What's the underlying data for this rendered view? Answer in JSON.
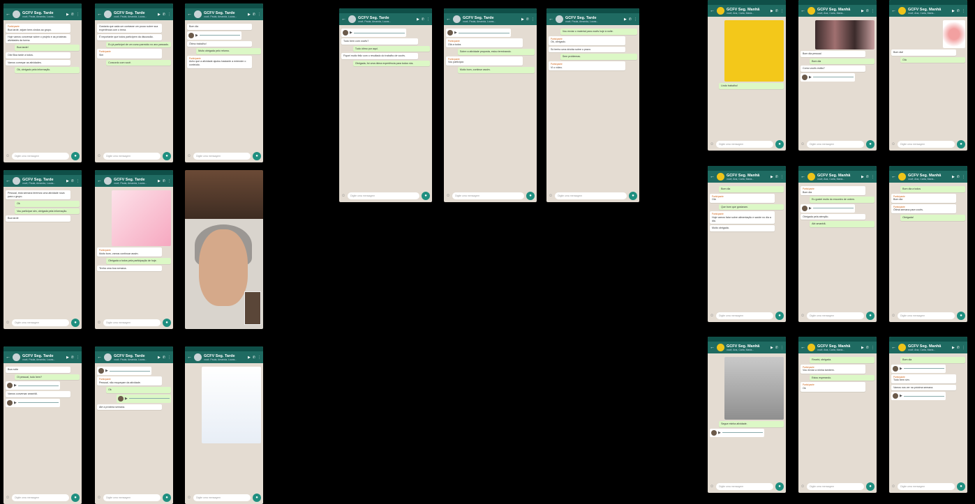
{
  "screens": [
    {
      "id": "p1",
      "title": "GCFV Seg. Tarde",
      "subtitle": "você, Paula, Amanda, Lucas...",
      "input": "Digite uma mensagem",
      "messages": [
        {
          "dir": "in",
          "sender": true,
          "text": "Boa tarde, sejam bem-vindos ao grupo."
        },
        {
          "dir": "in",
          "text": "Hoje vamos conversar sobre o projeto e as próximas atividades da turma."
        },
        {
          "dir": "out",
          "text": "Boa tarde!"
        },
        {
          "dir": "in",
          "text": "Olá! Boa tarde a todos."
        },
        {
          "dir": "in",
          "text": "Vamos começar as atividades."
        },
        {
          "dir": "out",
          "text": "Ok, obrigado pela informação."
        }
      ]
    },
    {
      "id": "p2",
      "title": "GCFV Seg. Tarde",
      "subtitle": "você, Paula, Amanda, Lucas...",
      "input": "Digite uma mensagem",
      "messages": [
        {
          "dir": "in",
          "text": "Gostaria que cada um contasse um pouco sobre sua experiência com o tema."
        },
        {
          "dir": "in",
          "text": "É importante que todos participem da discussão."
        },
        {
          "dir": "out",
          "text": "Eu já participei de um curso parecido no ano passado."
        },
        {
          "dir": "in",
          "sender": true,
          "text": "Sim"
        },
        {
          "dir": "out",
          "text": "Concordo com você."
        }
      ]
    },
    {
      "id": "p3",
      "title": "GCFV Seg. Tarde",
      "subtitle": "você, Paula, Amanda, Lucas...",
      "input": "Digite uma mensagem",
      "messages": [
        {
          "dir": "in",
          "text": "Bom dia"
        },
        {
          "dir": "audio-in"
        },
        {
          "dir": "in",
          "text": "Ótimo trabalho!"
        },
        {
          "dir": "out",
          "text": "Muito obrigada pelo retorno."
        },
        {
          "dir": "in",
          "sender": true,
          "text": "Acho que a atividade ajudou bastante a entender o conteúdo."
        }
      ]
    },
    {
      "id": "p4",
      "title": "GCFV Seg. Tarde",
      "subtitle": "você, Paula, Amanda, Lucas...",
      "input": "Digite uma mensagem",
      "messages": [
        {
          "dir": "in",
          "text": "Pessoal, esta semana teremos uma atividade nova para o grupo."
        },
        {
          "dir": "out",
          "text": "Ok"
        },
        {
          "dir": "out",
          "text": "Vou participar sim, obrigada pela informação."
        },
        {
          "dir": "in",
          "text": "Boa tarde"
        }
      ]
    },
    {
      "id": "p5",
      "title": "GCFV Seg. Tarde",
      "subtitle": "você, Paula, Amanda, Lucas...",
      "input": "Digite uma mensagem",
      "image": "pink",
      "messages": [
        {
          "dir": "in",
          "sender": true,
          "text": "Muito bom, vamos continuar assim."
        },
        {
          "dir": "out",
          "text": "Obrigada a todos pela participação de hoje."
        },
        {
          "dir": "in",
          "text": "Tenha uma boa semana."
        }
      ]
    },
    {
      "id": "p6",
      "video": true
    },
    {
      "id": "p7",
      "title": "GCFV Seg. Tarde",
      "subtitle": "você, Paula, Amanda, Lucas...",
      "input": "Digite uma mensagem",
      "messages": [
        {
          "dir": "in",
          "text": "Boa noite"
        },
        {
          "dir": "out",
          "text": "Oi pessoal, tudo bem?"
        },
        {
          "dir": "audio-in"
        },
        {
          "dir": "in",
          "text": "Vamos conversar amanhã."
        },
        {
          "dir": "audio-in"
        }
      ]
    },
    {
      "id": "p8",
      "title": "GCFV Seg. Tarde",
      "subtitle": "você, Paula, Amanda, Lucas...",
      "input": "Digite uma mensagem",
      "messages": [
        {
          "dir": "audio-in"
        },
        {
          "dir": "in",
          "sender": true,
          "text": "Pessoal, não esqueçam da atividade."
        },
        {
          "dir": "out",
          "text": "Ok"
        },
        {
          "dir": "audio-out"
        },
        {
          "dir": "in",
          "text": "Até a próxima semana."
        }
      ]
    },
    {
      "id": "p9",
      "title": "GCFV Seg. Tarde",
      "subtitle": "você, Paula, Amanda, Lucas...",
      "input": "Digite uma mensagem",
      "image": "flyer",
      "messages": []
    },
    {
      "id": "c1",
      "title": "GCFV Seg. Tarde",
      "subtitle": "você, Paula, Amanda, Lucas...",
      "input": "Digite uma mensagem",
      "messages": [
        {
          "dir": "audio-in"
        },
        {
          "dir": "in",
          "text": "Tudo bem com vocês?"
        },
        {
          "dir": "out",
          "text": "Tudo ótimo por aqui."
        },
        {
          "dir": "in",
          "text": "Fiquei muito feliz com o resultado do trabalho de vocês."
        },
        {
          "dir": "out",
          "text": "Obrigada, foi uma ótima experiência para todos nós."
        }
      ]
    },
    {
      "id": "c2",
      "title": "GCFV Seg. Tarde",
      "subtitle": "você, Paula, Amanda, Lucas...",
      "input": "Digite uma mensagem",
      "messages": [
        {
          "dir": "audio-in"
        },
        {
          "dir": "in",
          "sender": true,
          "text": "Olá a todos"
        },
        {
          "dir": "out",
          "text": "Sobre a atividade proposta, estou terminando."
        },
        {
          "dir": "in",
          "sender": true,
          "text": "Vou participar."
        },
        {
          "dir": "out",
          "text": "Muito bom, continue assim."
        }
      ]
    },
    {
      "id": "c3",
      "title": "GCFV Seg. Tarde",
      "subtitle": "você, Paula, Amanda, Lucas...",
      "input": "Digite uma mensagem",
      "messages": [
        {
          "dir": "out",
          "text": "Vou enviar o material para vocês hoje à noite."
        },
        {
          "dir": "in",
          "sender": true,
          "text": "Ok, obrigado."
        },
        {
          "dir": "in",
          "text": "Só tenho uma dúvida sobre o prazo."
        },
        {
          "dir": "out",
          "text": "Sem problemas."
        },
        {
          "dir": "in",
          "sender": true,
          "text": "Vi o vídeo."
        }
      ]
    },
    {
      "id": "r1",
      "title": "GCFV Seg. Manhã",
      "subtitle": "você, Ana, Carla, Maria...",
      "input": "Digite uma mensagem",
      "yellow": true,
      "image": "yellow",
      "messages": [
        {
          "dir": "out",
          "text": "Lindo trabalho!"
        }
      ]
    },
    {
      "id": "r2",
      "title": "GCFV Seg. Manhã",
      "subtitle": "você, Ana, Carla, Maria...",
      "input": "Digite uma mensagem",
      "yellow": true,
      "image": "group",
      "messages": [
        {
          "dir": "in",
          "text": "Bom dia pessoal"
        },
        {
          "dir": "out",
          "text": "Bom dia"
        },
        {
          "dir": "in",
          "text": "Como vocês estão?"
        },
        {
          "dir": "audio-in"
        }
      ]
    },
    {
      "id": "r3",
      "title": "GCFV Seg. Manhã",
      "subtitle": "você, Ana, Carla, Maria...",
      "input": "Digite uma mensagem",
      "yellow": true,
      "image": "sticker",
      "messages": [
        {
          "dir": "in",
          "text": "Bom dia!"
        },
        {
          "dir": "out",
          "text": "Olá"
        }
      ]
    },
    {
      "id": "r4",
      "title": "GCFV Seg. Manhã",
      "subtitle": "você, Ana, Carla, Maria...",
      "input": "Digite uma mensagem",
      "yellow": true,
      "messages": [
        {
          "dir": "out",
          "text": "Bom dia"
        },
        {
          "dir": "in",
          "sender": true,
          "text": "Olá"
        },
        {
          "dir": "out",
          "text": "Que bom que gostaram."
        },
        {
          "dir": "in",
          "sender": true,
          "text": "Hoje vamos falar sobre alimentação e saúde no dia a dia."
        },
        {
          "dir": "in",
          "text": "Muito obrigada."
        }
      ]
    },
    {
      "id": "r5",
      "title": "GCFV Seg. Manhã",
      "subtitle": "você, Ana, Carla, Maria...",
      "input": "Digite uma mensagem",
      "yellow": true,
      "messages": [
        {
          "dir": "in",
          "sender": true,
          "text": "Bom dia"
        },
        {
          "dir": "out",
          "text": "Eu gostei muito do encontro de ontem."
        },
        {
          "dir": "audio-in"
        },
        {
          "dir": "in",
          "text": "Obrigada pela atenção."
        },
        {
          "dir": "out",
          "text": "Até amanhã."
        }
      ]
    },
    {
      "id": "r6",
      "title": "GCFV Seg. Manhã",
      "subtitle": "você, Ana, Carla, Maria...",
      "input": "Digite uma mensagem",
      "yellow": true,
      "messages": [
        {
          "dir": "out",
          "text": "Bom dia a todos"
        },
        {
          "dir": "in",
          "sender": true,
          "text": "Bom dia"
        },
        {
          "dir": "in",
          "sender": true,
          "text": "Ótima semana para vocês."
        },
        {
          "dir": "out",
          "text": "Obrigada!"
        }
      ]
    },
    {
      "id": "r7",
      "title": "GCFV Seg. Manhã",
      "subtitle": "você, Ana, Carla, Maria...",
      "input": "Digite uma mensagem",
      "yellow": true,
      "image": "paper",
      "messages": [
        {
          "dir": "out",
          "text": "Segue minha atividade."
        },
        {
          "dir": "audio-in"
        }
      ]
    },
    {
      "id": "r8",
      "title": "GCFV Seg. Manhã",
      "subtitle": "você, Ana, Carla, Maria...",
      "input": "Digite uma mensagem",
      "yellow": true,
      "messages": [
        {
          "dir": "out",
          "text": "Recebi, obrigada."
        },
        {
          "dir": "in",
          "sender": true,
          "text": "Vou enviar a minha também."
        },
        {
          "dir": "out",
          "text": "Estou esperando."
        },
        {
          "dir": "in",
          "sender": true,
          "text": "Ok"
        }
      ]
    },
    {
      "id": "r9",
      "title": "GCFV Seg. Manhã",
      "subtitle": "você, Ana, Carla, Maria...",
      "input": "Digite uma mensagem",
      "yellow": true,
      "messages": [
        {
          "dir": "out",
          "text": "Bom dia"
        },
        {
          "dir": "audio-in"
        },
        {
          "dir": "in",
          "sender": true,
          "text": "Tudo bem sim."
        },
        {
          "dir": "in",
          "text": "Vamos nos ver na próxima semana."
        },
        {
          "dir": "audio-in"
        }
      ]
    }
  ]
}
